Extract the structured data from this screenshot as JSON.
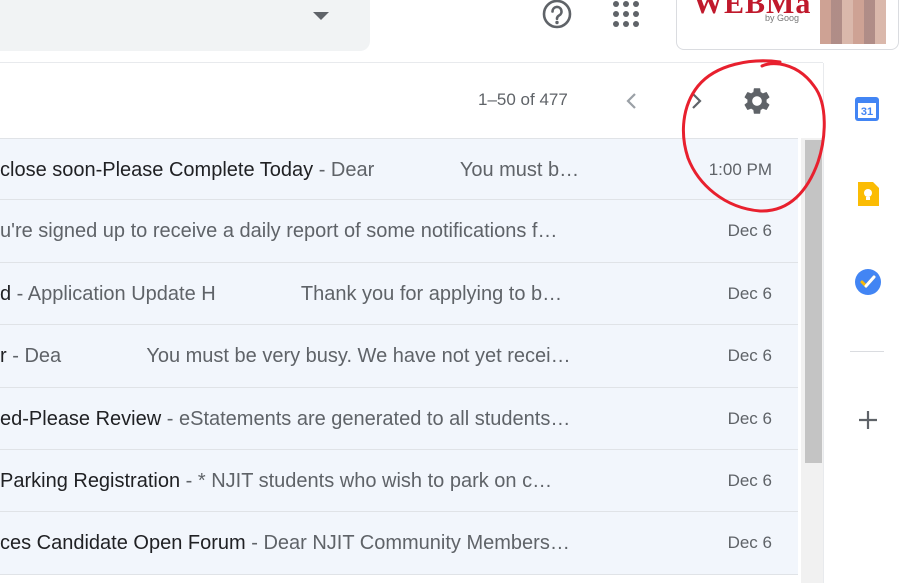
{
  "header": {
    "logo_text": "WEBMa",
    "logo_sub": "by Goog"
  },
  "toolbar": {
    "pagination": "1–50 of 477"
  },
  "emails": [
    {
      "subject": "close soon-Please Complete Today",
      "snippet": " - Dear     You must b…",
      "date": "1:00 PM"
    },
    {
      "subject": "",
      "snippet": "u're signed up to receive a daily report of some notifications f…",
      "date": "Dec 6"
    },
    {
      "subject": "d",
      "snippet": " - Application Update H     Thank you for applying to b…",
      "date": "Dec 6"
    },
    {
      "subject": "r",
      "snippet": " - Dea     You must be very busy. We have not yet recei…",
      "date": "Dec 6"
    },
    {
      "subject": "ed-Please Review",
      "snippet": " - eStatements are generated to all students…",
      "date": "Dec 6"
    },
    {
      "subject": " Parking Registration",
      "snippet": " - * NJIT students who wish to park on c…",
      "date": "Dec 6"
    },
    {
      "subject": "ces Candidate Open Forum",
      "snippet": " - Dear NJIT Community Members…",
      "date": "Dec 6"
    }
  ],
  "side_panel": {
    "calendar_day": "31"
  },
  "colors": {
    "annotation_red": "#e8202e",
    "row_background": "#f2f6fc",
    "calendar_blue": "#4285f4",
    "keep_yellow": "#fbbc04"
  },
  "icons": [
    "search-dropdown-icon",
    "help-icon",
    "apps-icon",
    "prev-page-icon",
    "next-page-icon",
    "settings-icon",
    "calendar-icon",
    "keep-icon",
    "tasks-icon",
    "add-addon-icon"
  ]
}
